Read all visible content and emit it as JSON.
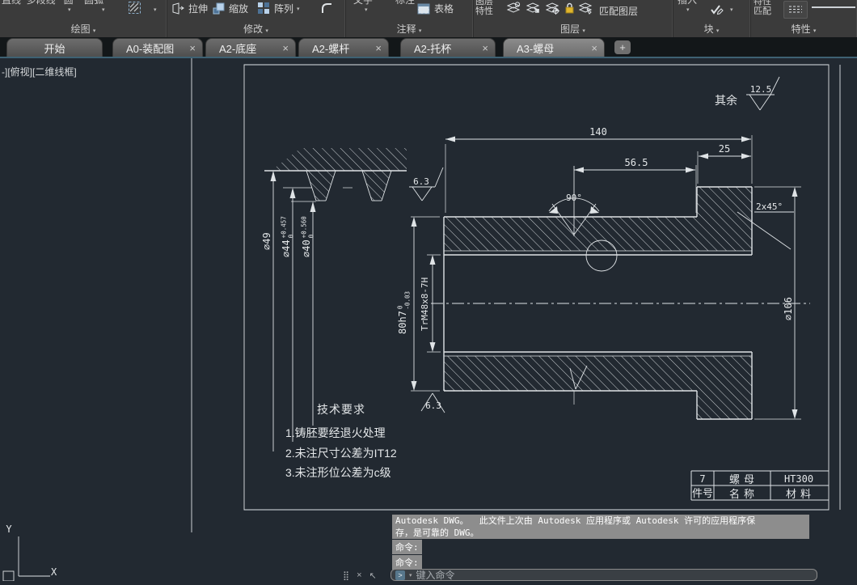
{
  "ribbon": {
    "panels": [
      {
        "label": "绘图",
        "clipped": "直线  多段线   圆    圆弧"
      },
      {
        "label": "修改",
        "buttons": [
          {
            "label": "拉伸"
          },
          {
            "label": "缩放"
          },
          {
            "label": "阵列"
          }
        ]
      },
      {
        "label": "注释",
        "clipped_text": "文字",
        "clipped_dim": "标注",
        "buttons": [
          {
            "label": "表格"
          }
        ]
      },
      {
        "label": "图层",
        "stack_top": "图层",
        "stack_bottom": "特性",
        "match_label": "匹配图层"
      },
      {
        "label": "块",
        "clipped": "插入"
      },
      {
        "label": "特性",
        "stack_top": "特性",
        "stack_bottom": "匹配"
      }
    ]
  },
  "tabs": {
    "close_glyph": "×",
    "new_tab": "+",
    "items": [
      {
        "label": "开始"
      },
      {
        "label": "A0-装配图"
      },
      {
        "label": "A2-底座"
      },
      {
        "label": "A2-螺杆"
      },
      {
        "label": "A2-托杯"
      },
      {
        "label": "A3-螺母"
      }
    ]
  },
  "drawing": {
    "viewport_label": "-][俯视][二维线框]",
    "surface_note_label": "其余",
    "surface_note_value": "12.5",
    "roughness_upper": "6.3",
    "roughness_lower": "6.3",
    "dims": {
      "total_length": "140",
      "flange_width": "25",
      "hole_offset": "56.5",
      "countersink": "90°",
      "chamfer": "2x45°",
      "flange_dia": "∅106",
      "body_dia": "80h7",
      "body_dia_tol_up": "0",
      "body_dia_tol_dn": "-0.03",
      "thread_spec": "TrM48x8-7H",
      "crest_dia": "∅49",
      "mid_dia": "∅44",
      "mid_dia_tol_up": "+0.457",
      "mid_dia_tol_dn": "0",
      "root_dia": "∅40",
      "root_dia_tol_up": "+0.560",
      "root_dia_tol_dn": "0"
    },
    "tech_req_title": "技术要求",
    "tech_req_1": "1.铸胚要经退火处理",
    "tech_req_2": "2.未注尺寸公差为IT12",
    "tech_req_3": "3.未注形位公差为c级",
    "title_block": {
      "r1c1": "7",
      "r1c2": "螺母",
      "r1c3": "HT300",
      "r2c1": "件号",
      "r2c2": "名称",
      "r2c3": "材料"
    },
    "ucs_x": "X",
    "ucs_y": "Y"
  },
  "command": {
    "history_1": "Autodesk DWG。  此文件上次由 Autodesk 应用程序或 Autodesk 许可的应用程序保",
    "history_2": "存，是可靠的 DWG。",
    "prompt_1": "命令:",
    "prompt_2": "命令:",
    "input_placeholder": "键入命令"
  }
}
